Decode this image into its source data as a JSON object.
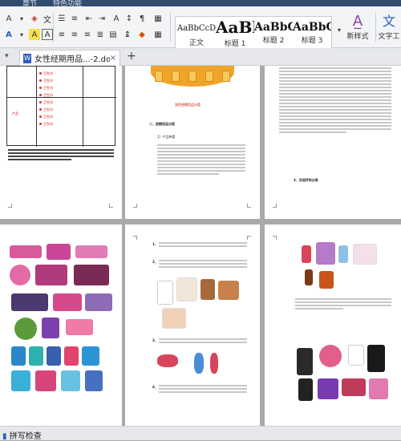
{
  "menu": {
    "items": [
      "章节",
      "特色功能"
    ]
  },
  "ribbon": {
    "styles": [
      {
        "sample": "AaBbCcDd",
        "name": "正文"
      },
      {
        "sample": "AaBl",
        "name": "标题 1"
      },
      {
        "sample": "AaBbCc",
        "name": "标题 2"
      },
      {
        "sample": "AaBbC",
        "name": "标题 3"
      }
    ],
    "new_style": "新样式",
    "text_tool": "文字工",
    "more_arrow": "▾"
  },
  "tab": {
    "doc_title": "女性经期用品...-2.doc",
    "add": "+"
  },
  "status": {
    "spell_check": "拼写检查"
  },
  "pages": {
    "p1": {
      "table_rows": [
        "卫生巾",
        "卫生巾",
        "卫生巾",
        "卫生巾",
        "卫生巾",
        "卫生巾",
        "卫生巾",
        "卫生巾"
      ],
      "row_label": "产品"
    },
    "p2": {
      "diagram_label": "女性经期用品分类",
      "heading": "二、经期用品分类",
      "sub": "1）产品种类"
    },
    "p3": {
      "heading": "3、月经杯的分类"
    },
    "p5": {
      "item1": "1、",
      "item2": "2、",
      "item3": "3、",
      "item4": "4、"
    }
  },
  "colors": {
    "accent": "#2f4b6e",
    "orange": "#f0a42a"
  }
}
